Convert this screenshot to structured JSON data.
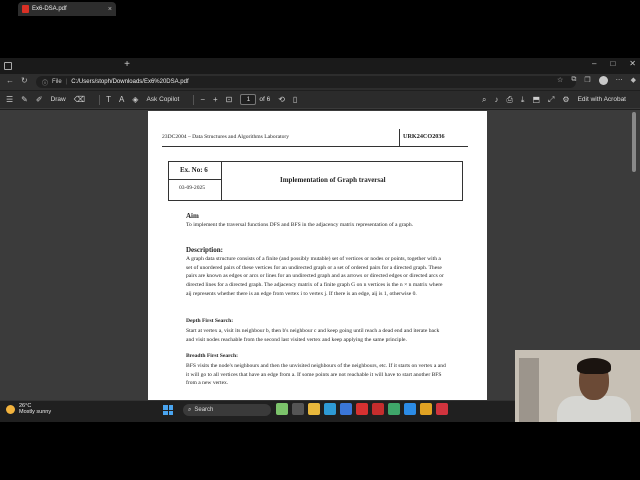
{
  "browser": {
    "tab_title": "Ex6-DSA.pdf",
    "tab_close": "×",
    "new_tab": "+",
    "url_label": "File",
    "url": "C:/Users/stoph/Downloads/Ex6%20DSA.pdf"
  },
  "toolbar": {
    "draw_label": "Draw",
    "ask_copilot_label": "Ask Copilot",
    "page_current": "1",
    "page_total": "of 6",
    "edit_acrobat_label": "Edit with Acrobat"
  },
  "document": {
    "course": "23DC2004 – Data Structures and Algorithms Laboratory",
    "roll_no": "URK24CO2036",
    "ex_no": "Ex. No: 6",
    "date": "03-09-2025",
    "title": "Implementation of Graph traversal",
    "aim_heading": "Aim",
    "aim_text": "To implement the traversal functions DFS and BFS in the adjacency matrix representation of a graph.",
    "desc_heading": "Description:",
    "desc_text": "A graph data structure consists of a finite (and possibly mutable) set of vertices or nodes or points, together with a set of unordered pairs of these vertices for an undirected graph or a set of ordered pairs for a directed graph. These pairs are known as edges or arcs or lines for an undirected graph and as arrows or directed edges or directed arcs or directed lines for a directed graph. The adjacency matrix of a finite graph G on n vertices is the n × n matrix where aij represents whether there is an edge from vertex i to vertex j. If there is an edge, aij is 1, otherwise 0.",
    "dfs_heading": "Depth First Search:",
    "dfs_text": "Start at vertex a, visit its neighbour b, then b's neighbour c and keep going until reach a dead end and iterate back and visit nodes reachable from the second last visited vertex and keep applying the same principle.",
    "bfs_heading": "Breadth First Search:",
    "bfs_text": "BFS visits the node's neighbours and then the unvisited neighbours of the neighbours, etc. If it starts on vertex a and it will go to all vertices that have an edge from a. If some points are not reachable it will have to start another BFS from a new vertex."
  },
  "taskbar": {
    "temperature": "26°C",
    "weather": "Mostly sunny",
    "search_label": "Search"
  },
  "colors": {
    "pdf_red": "#d93025",
    "windows_blue": "#4aa5f0"
  }
}
